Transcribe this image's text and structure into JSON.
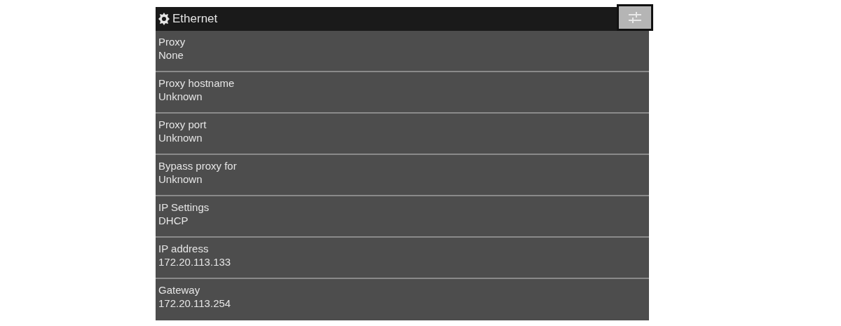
{
  "header": {
    "title": "Ethernet"
  },
  "rows": [
    {
      "label": "Proxy",
      "value": "None"
    },
    {
      "label": "Proxy hostname",
      "value": "Unknown"
    },
    {
      "label": "Proxy port",
      "value": "Unknown"
    },
    {
      "label": "Bypass proxy for",
      "value": "Unknown"
    },
    {
      "label": "IP Settings",
      "value": "DHCP"
    },
    {
      "label": "IP address",
      "value": "172.20.113.133"
    },
    {
      "label": "Gateway",
      "value": "172.20.113.254"
    }
  ]
}
